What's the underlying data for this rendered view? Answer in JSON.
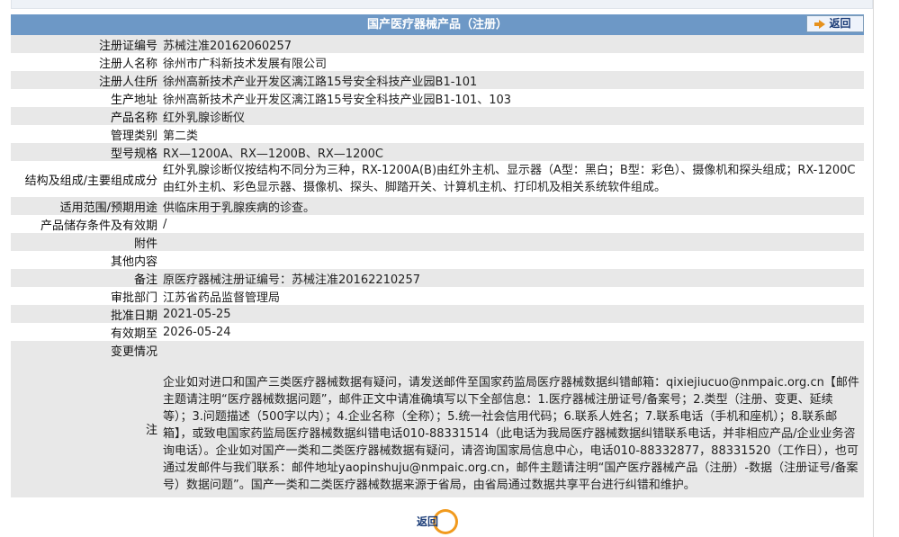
{
  "title": "国产医疗器械产品（注册）",
  "back_label": "返回",
  "rows": [
    {
      "label": "注册证编号",
      "value": "苏械注准20162060257"
    },
    {
      "label": "注册人名称",
      "value": "徐州市广科新技术发展有限公司"
    },
    {
      "label": "注册人住所",
      "value": "徐州高新技术产业开发区漓江路15号安全科技产业园B1-101"
    },
    {
      "label": "生产地址",
      "value": "徐州高新技术产业开发区漓江路15号安全科技产业园B1-101、103"
    },
    {
      "label": "产品名称",
      "value": "红外乳腺诊断仪"
    },
    {
      "label": "管理类别",
      "value": "第二类"
    },
    {
      "label": "型号规格",
      "value": "RX—1200A、RX—1200B、RX—1200C"
    },
    {
      "label": "结构及组成/主要组成成分",
      "value": "红外乳腺诊断仪按结构不同分为三种，RX-1200A(B)由红外主机、显示器（A型：黑白；B型：彩色）、摄像机和探头组成；RX-1200C由红外主机、彩色显示器、摄像机、探头、脚踏开关、计算机主机、打印机及相关系统软件组成。"
    },
    {
      "label": "适用范围/预期用途",
      "value": "供临床用于乳腺疾病的诊查。"
    },
    {
      "label": "产品储存条件及有效期",
      "value": "/"
    },
    {
      "label": "附件",
      "value": ""
    },
    {
      "label": "其他内容",
      "value": ""
    },
    {
      "label": "备注",
      "value": "原医疗器械注册证编号：苏械注准20162210257"
    },
    {
      "label": "审批部门",
      "value": "江苏省药品监督管理局"
    },
    {
      "label": "批准日期",
      "value": "2021-05-25"
    },
    {
      "label": "有效期至",
      "value": "2026-05-24"
    },
    {
      "label": "变更情况",
      "value": ""
    }
  ],
  "note": {
    "label": "注",
    "text": "企业如对进口和国产三类医疗器械数据有疑问，请发送邮件至国家药监局医疗器械数据纠错邮箱：qixiejiucuo@nmpaic.org.cn【邮件主题请注明“医疗器械数据问题”，邮件正文中请准确填写以下全部信息：1.医疗器械注册证号/备案号；2.类型（注册、变更、延续等）；3.问题描述（500字以内）；4.企业名称（全称）；5.统一社会信用代码；6.联系人姓名；7.联系电话（手机和座机）；8.联系邮箱】，或致电国家药监局医疗器械数据纠错电话010-88331514（此电话为我局医疗器械数据纠错联系电话，并非相应产品/企业业务咨询电话）。企业如对国产一类和二类医疗器械数据有疑问，请咨询国家局信息中心，电话010-88332877，88331520（工作日），也可通过发邮件与我们联系：邮件地址yaopinshuju@nmpaic.org.cn，邮件主题请注明“国产医疗器械产品（注册）-数据（注册证号/备案号）数据问题”。国产一类和二类医疗器械数据来源于省局，由省局通过数据共享平台进行纠错和维护。"
  }
}
